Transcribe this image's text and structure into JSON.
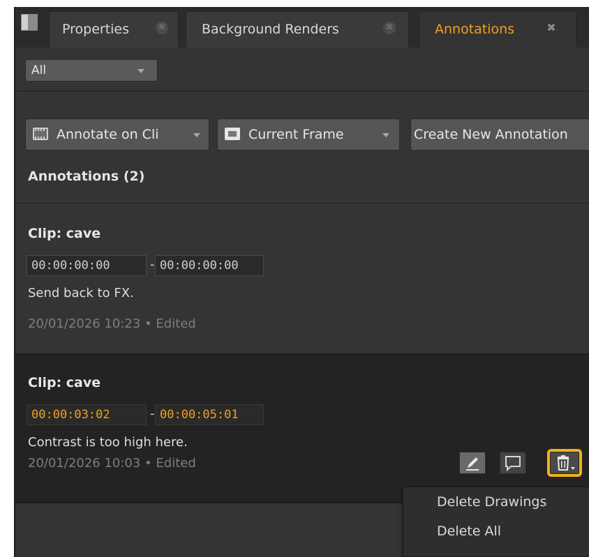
{
  "tabs": [
    {
      "label": "Properties",
      "active": false
    },
    {
      "label": "Background Renders",
      "active": false
    },
    {
      "label": "Annotations",
      "active": true
    }
  ],
  "filter": {
    "selected": "All"
  },
  "toolbar": {
    "annotate_on_label": "Annotate on Cli",
    "frame_label": "Current Frame",
    "create_label": "Create New Annotation"
  },
  "section_title": "Annotations (2)",
  "annotations": [
    {
      "clip": "Clip: cave",
      "tc_in": "00:00:00:00",
      "tc_out": "00:00:00:00",
      "separator": "-",
      "note": "Send back to FX.",
      "meta": "20/01/2026 10:23 • Edited"
    },
    {
      "clip": "Clip: cave",
      "tc_in": "00:00:03:02",
      "tc_out": "00:00:05:01",
      "separator": "-",
      "note": "Contrast is too high here.",
      "meta": "20/01/2026 10:03 • Edited"
    }
  ],
  "action_icons": [
    "pencil-icon",
    "comment-icon",
    "trash-icon"
  ],
  "delete_menu": {
    "items": [
      "Delete Drawings",
      "Delete All"
    ]
  },
  "colors": {
    "accent": "#f0a024",
    "highlight_outline": "#f3b21a",
    "panel_bg": "#343434",
    "selected_card_bg": "#232323"
  }
}
